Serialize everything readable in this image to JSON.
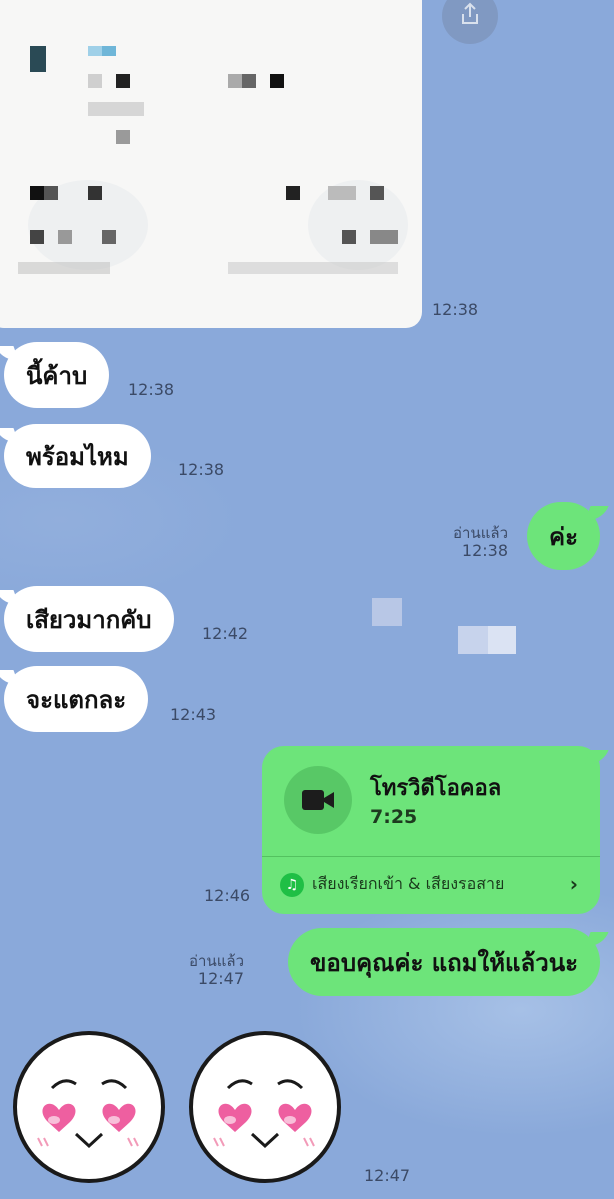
{
  "messages": [
    {
      "side": "in",
      "type": "image",
      "time": "12:38"
    },
    {
      "side": "in",
      "text": "นี้ค้าบ",
      "time": "12:38"
    },
    {
      "side": "in",
      "text": "พร้อมไหม",
      "time": "12:38"
    },
    {
      "side": "out",
      "text": "ค่ะ",
      "read": "อ่านแล้ว",
      "time": "12:38"
    },
    {
      "side": "in",
      "text": "เสียวมากคับ",
      "time": "12:42"
    },
    {
      "side": "in",
      "text": "จะแตกละ",
      "time": "12:43"
    },
    {
      "side": "out",
      "type": "call",
      "title": "โทรวิดีโอคอล",
      "duration": "7:25",
      "ringtone_label": "เสียงเรียกเข้า & เสียงรอสาย",
      "time": "12:46"
    },
    {
      "side": "out",
      "text": "ขอบคุณค่ะ แถมให้แล้วนะ",
      "read": "อ่านแล้ว",
      "time": "12:47"
    },
    {
      "side": "in",
      "type": "sticker",
      "time": "12:47"
    }
  ],
  "icons": {
    "share": "share-icon",
    "video": "video-camera-icon",
    "music": "music-note-icon",
    "chevron": "chevron-right-icon",
    "sticker": "heart-eyes-face-icon"
  },
  "colors": {
    "background": "#8aa9da",
    "incoming_bubble": "#ffffff",
    "outgoing_bubble": "#6de47a",
    "call_icon_circle": "#58c866",
    "music_icon": "#1fbf45"
  }
}
